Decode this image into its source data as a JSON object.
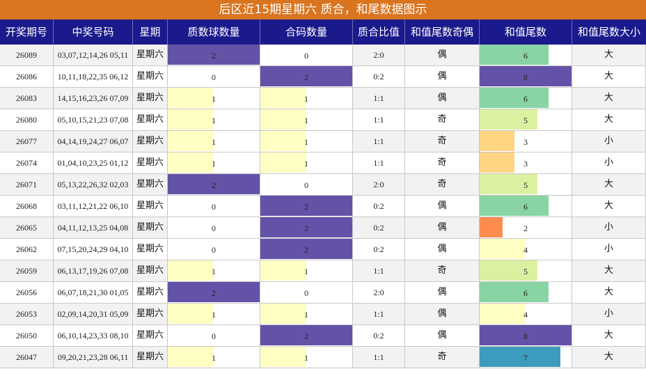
{
  "chart_data": {
    "type": "table",
    "title": "后区近15期星期六 质合，和尾数据图示",
    "columns": [
      "开奖期号",
      "中奖号码",
      "星期",
      "质数球数量",
      "合码数量",
      "质合比值",
      "和值尾数奇偶",
      "和值尾数",
      "和值尾数大小"
    ],
    "bar_max": {
      "prime": 2,
      "composite": 2,
      "tail": 8
    },
    "colors": {
      "title_bg": "#d9741f",
      "header_bg": "#1a1a8c",
      "count": {
        "0": "",
        "1": "#ffffc4",
        "2": "#6452a8"
      },
      "tail": {
        "2": "#ff8c4e",
        "3": "#ffd583",
        "4": "#ffffc4",
        "5": "#dbf0a0",
        "6": "#88d4a4",
        "7": "#3d9bbd",
        "8": "#6452a8"
      }
    },
    "rows": [
      {
        "issue": "26089",
        "numbers": "03,07,12,14,26 05,11",
        "weekday": "星期六",
        "prime": 2,
        "composite": 0,
        "ratio": "2:0",
        "parity": "偶",
        "tail": 6,
        "size": "大"
      },
      {
        "issue": "26086",
        "numbers": "10,11,18,22,35 06,12",
        "weekday": "星期六",
        "prime": 0,
        "composite": 2,
        "ratio": "0:2",
        "parity": "偶",
        "tail": 8,
        "size": "大"
      },
      {
        "issue": "26083",
        "numbers": "14,15,16,23,26 07,09",
        "weekday": "星期六",
        "prime": 1,
        "composite": 1,
        "ratio": "1:1",
        "parity": "偶",
        "tail": 6,
        "size": "大"
      },
      {
        "issue": "26080",
        "numbers": "05,10,15,21,23 07,08",
        "weekday": "星期六",
        "prime": 1,
        "composite": 1,
        "ratio": "1:1",
        "parity": "奇",
        "tail": 5,
        "size": "大"
      },
      {
        "issue": "26077",
        "numbers": "04,14,19,24,27 06,07",
        "weekday": "星期六",
        "prime": 1,
        "composite": 1,
        "ratio": "1:1",
        "parity": "奇",
        "tail": 3,
        "size": "小"
      },
      {
        "issue": "26074",
        "numbers": "01,04,10,23,25 01,12",
        "weekday": "星期六",
        "prime": 1,
        "composite": 1,
        "ratio": "1:1",
        "parity": "奇",
        "tail": 3,
        "size": "小"
      },
      {
        "issue": "26071",
        "numbers": "05,13,22,26,32 02,03",
        "weekday": "星期六",
        "prime": 2,
        "composite": 0,
        "ratio": "2:0",
        "parity": "奇",
        "tail": 5,
        "size": "大"
      },
      {
        "issue": "26068",
        "numbers": "03,11,12,21,22 06,10",
        "weekday": "星期六",
        "prime": 0,
        "composite": 2,
        "ratio": "0:2",
        "parity": "偶",
        "tail": 6,
        "size": "大"
      },
      {
        "issue": "26065",
        "numbers": "04,11,12,13,25 04,08",
        "weekday": "星期六",
        "prime": 0,
        "composite": 2,
        "ratio": "0:2",
        "parity": "偶",
        "tail": 2,
        "size": "小"
      },
      {
        "issue": "26062",
        "numbers": "07,15,20,24,29 04,10",
        "weekday": "星期六",
        "prime": 0,
        "composite": 2,
        "ratio": "0:2",
        "parity": "偶",
        "tail": 4,
        "size": "小"
      },
      {
        "issue": "26059",
        "numbers": "06,13,17,19,26 07,08",
        "weekday": "星期六",
        "prime": 1,
        "composite": 1,
        "ratio": "1:1",
        "parity": "奇",
        "tail": 5,
        "size": "大"
      },
      {
        "issue": "26056",
        "numbers": "06,07,18,21,30 01,05",
        "weekday": "星期六",
        "prime": 2,
        "composite": 0,
        "ratio": "2:0",
        "parity": "偶",
        "tail": 6,
        "size": "大"
      },
      {
        "issue": "26053",
        "numbers": "02,09,14,20,31 05,09",
        "weekday": "星期六",
        "prime": 1,
        "composite": 1,
        "ratio": "1:1",
        "parity": "偶",
        "tail": 4,
        "size": "小"
      },
      {
        "issue": "26050",
        "numbers": "06,10,14,23,33 08,10",
        "weekday": "星期六",
        "prime": 0,
        "composite": 2,
        "ratio": "0:2",
        "parity": "偶",
        "tail": 8,
        "size": "大"
      },
      {
        "issue": "26047",
        "numbers": "09,20,21,23,28 06,11",
        "weekday": "星期六",
        "prime": 1,
        "composite": 1,
        "ratio": "1:1",
        "parity": "奇",
        "tail": 7,
        "size": "大"
      }
    ]
  }
}
